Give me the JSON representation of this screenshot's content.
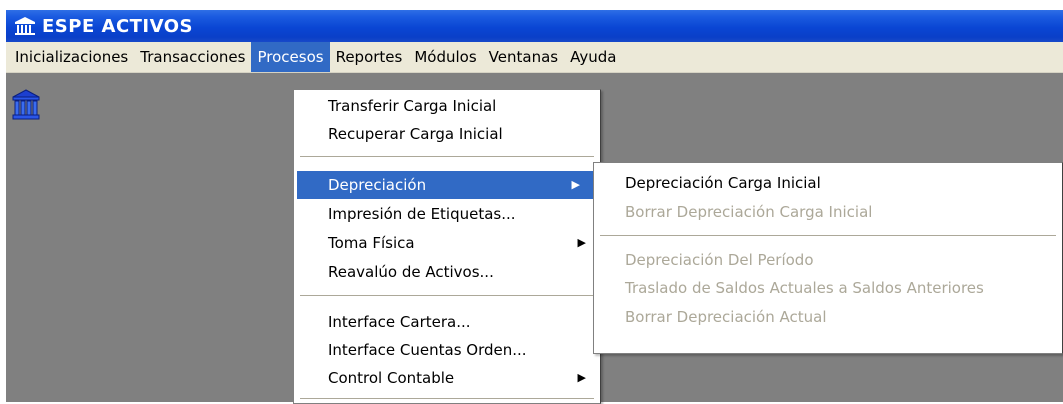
{
  "window": {
    "title": "ESPE ACTIVOS"
  },
  "menubar": {
    "items": [
      {
        "label": "Inicializaciones"
      },
      {
        "label": "Transacciones"
      },
      {
        "label": "Procesos"
      },
      {
        "label": "Reportes"
      },
      {
        "label": "Módulos"
      },
      {
        "label": "Ventanas"
      },
      {
        "label": "Ayuda"
      }
    ],
    "active_index": 2
  },
  "procesos_menu": {
    "items": [
      {
        "label": "Transferir Carga Inicial"
      },
      {
        "label": "Recuperar Carga Inicial"
      },
      {
        "label": "Depreciación",
        "submenu": true,
        "highlighted": true
      },
      {
        "label": "Impresión de Etiquetas..."
      },
      {
        "label": "Toma Física",
        "submenu": true
      },
      {
        "label": "Reavalúo de Activos..."
      },
      {
        "label": "Interface Cartera..."
      },
      {
        "label": "Interface Cuentas Orden..."
      },
      {
        "label": "Control Contable",
        "submenu": true
      }
    ]
  },
  "depreciacion_submenu": {
    "items": [
      {
        "label": "Depreciación Carga Inicial",
        "enabled": true
      },
      {
        "label": "Borrar Depreciación Carga Inicial",
        "enabled": false
      },
      {
        "label": "Depreciación Del Período",
        "enabled": false
      },
      {
        "label": "Traslado de Saldos Actuales a Saldos Anteriores",
        "enabled": false
      },
      {
        "label": "Borrar Depreciación Actual",
        "enabled": false
      }
    ]
  },
  "icons": {
    "app": "building-columns-icon",
    "submenu_arrow": "triangle-right-icon"
  },
  "colors": {
    "highlight": "#316ac5",
    "titlebar": "#0a46d4",
    "menubar": "#ece9d8",
    "disabled_text": "#aca899",
    "desktop": "#808080"
  }
}
